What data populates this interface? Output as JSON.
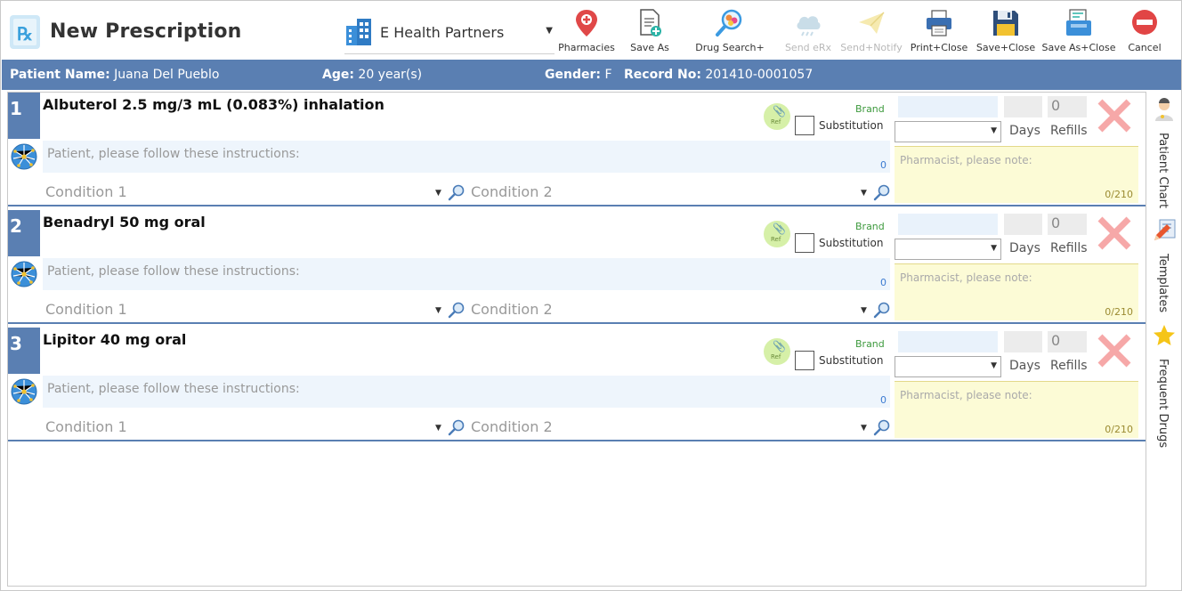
{
  "app": {
    "title": "New Prescription",
    "organization": "E Health Partners"
  },
  "toolbar": {
    "pharmacies": "Pharmacies",
    "save_as": "Save As",
    "drug_search": "Drug Search+",
    "send_erx": "Send eRx",
    "send_notify": "Send+Notify",
    "print_close": "Print+Close",
    "save_close": "Save+Close",
    "save_as_close": "Save As+Close",
    "cancel": "Cancel"
  },
  "patient": {
    "name_label": "Patient Name:",
    "name": "Juana Del Pueblo",
    "age_label": "Age:",
    "age": "20 year(s)",
    "gender_label": "Gender:",
    "gender": "F",
    "record_label": "Record No:",
    "record": "201410-0001057"
  },
  "rx": [
    {
      "num": "1",
      "drug": "Albuterol 2.5 mg/3 mL (0.083%) inhalation",
      "ref": "Ref",
      "brand": "Brand",
      "substitution": "Substitution",
      "refills_value": "0",
      "days_label": "Days",
      "refills_label": "Refills",
      "instructions_placeholder": "Patient, please follow these instructions:",
      "instructions_count": "0",
      "pharmacist_placeholder": "Pharmacist, please note:",
      "pharmacist_count": "0/210",
      "condition1": "Condition 1",
      "condition2": "Condition 2"
    },
    {
      "num": "2",
      "drug": "Benadryl 50 mg oral",
      "ref": "Ref",
      "brand": "Brand",
      "substitution": "Substitution",
      "refills_value": "0",
      "days_label": "Days",
      "refills_label": "Refills",
      "instructions_placeholder": "Patient, please follow these instructions:",
      "instructions_count": "0",
      "pharmacist_placeholder": "Pharmacist, please note:",
      "pharmacist_count": "0/210",
      "condition1": "Condition 1",
      "condition2": "Condition 2"
    },
    {
      "num": "3",
      "drug": "Lipitor 40 mg oral",
      "ref": "Ref",
      "brand": "Brand",
      "substitution": "Substitution",
      "refills_value": "0",
      "days_label": "Days",
      "refills_label": "Refills",
      "instructions_placeholder": "Patient, please follow these instructions:",
      "instructions_count": "0",
      "pharmacist_placeholder": "Pharmacist, please note:",
      "pharmacist_count": "0/210",
      "condition1": "Condition 1",
      "condition2": "Condition 2"
    }
  ],
  "side_tabs": {
    "patient_chart": "Patient Chart",
    "templates": "Templates",
    "frequent_drugs": "Frequent Drugs"
  },
  "colors": {
    "accent": "#5a7fb2",
    "brand_green": "#3e9a3e",
    "delete_red": "#f4a6a6",
    "note_yellow": "#fcfbd6",
    "instructions_blue": "#eef5fc"
  },
  "icons": {
    "app": "prescription-icon",
    "organization": "building-icon",
    "pharmacies": "map-pin-icon",
    "save_as": "document-add-icon",
    "drug_search": "pill-search-icon",
    "send_erx": "cloud-icon",
    "send_notify": "paper-plane-icon",
    "print_close": "printer-icon",
    "save_close": "floppy-disk-icon",
    "save_as_close": "stacked-documents-icon",
    "cancel": "cancel-icon",
    "delete": "red-x-icon",
    "instructions": "globe-network-icon",
    "condition_search": "magnifier-icon",
    "patient_chart": "doctor-icon",
    "templates": "template-pencil-icon",
    "frequent_drugs": "star-icon"
  }
}
